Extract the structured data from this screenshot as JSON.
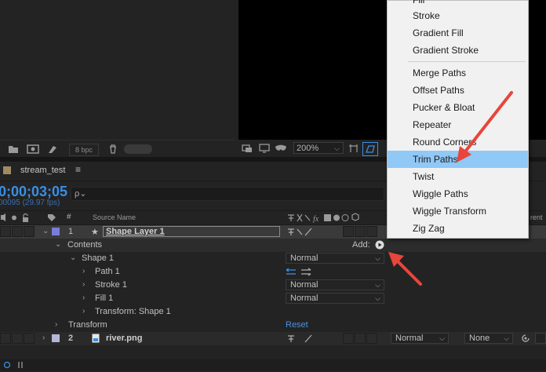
{
  "project_panel": {
    "bpc_label": "8 bpc"
  },
  "viewer_toolbar": {
    "zoom": "200%"
  },
  "timeline": {
    "tab_label": "stream_test",
    "timecode": "0;00;03;05",
    "fps": "00095 (29.97 fps)",
    "search_icon_glyph": "ρ⌄",
    "columns": {
      "index": "#",
      "source_name": "Source Name",
      "parent_partial": "rent"
    },
    "layers": [
      {
        "number": "1",
        "name": "Shape Layer 1"
      },
      {
        "number": "2",
        "name": "river.png",
        "mode": "Normal",
        "trkmat": "None"
      }
    ],
    "rows": {
      "contents": "Contents",
      "add_label": "Add:",
      "shape1": "Shape 1",
      "shape1_mode": "Normal",
      "path1": "Path 1",
      "stroke1": "Stroke 1",
      "stroke1_mode": "Normal",
      "fill1": "Fill 1",
      "fill1_mode": "Normal",
      "transform_shape1": "Transform: Shape 1",
      "transform": "Transform",
      "reset": "Reset"
    }
  },
  "add_menu": {
    "items_top": [
      "Fill",
      "Stroke",
      "Gradient Fill",
      "Gradient Stroke"
    ],
    "items_bottom": [
      "Merge Paths",
      "Offset Paths",
      "Pucker & Bloat",
      "Repeater",
      "Round Corners",
      "Trim Paths",
      "Twist",
      "Wiggle Paths",
      "Wiggle Transform",
      "Zig Zag"
    ],
    "highlighted": "Trim Paths"
  },
  "annotation_color": "#e8453c"
}
